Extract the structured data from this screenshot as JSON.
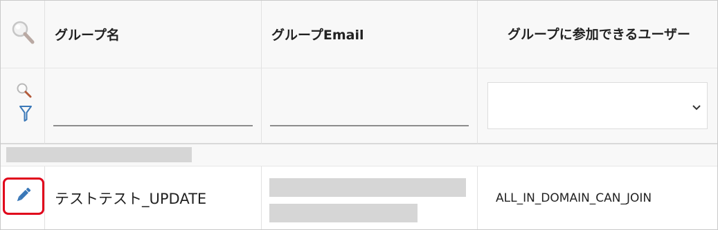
{
  "table": {
    "columns": [
      {
        "label": "グループ名"
      },
      {
        "label": "グループEmail"
      },
      {
        "label": "グループに参加できるユーザー"
      }
    ],
    "filter": {
      "name_value": "",
      "email_value": "",
      "join_select_value": ""
    },
    "rows": [
      {
        "name": "テストテスト_UPDATE",
        "email": "",
        "who_can_join": "ALL_IN_DOMAIN_CAN_JOIN"
      }
    ]
  },
  "icons": {
    "header_search": "search-icon",
    "filter_search": "search-icon",
    "filter_funnel": "filter-icon",
    "edit": "pencil-icon",
    "select_chevron": "chevron-down-icon"
  },
  "colors": {
    "edit_highlight": "#e0001a",
    "pencil": "#3a78b8",
    "funnel": "#3a78b8",
    "search_handle": "#b35a3a"
  }
}
